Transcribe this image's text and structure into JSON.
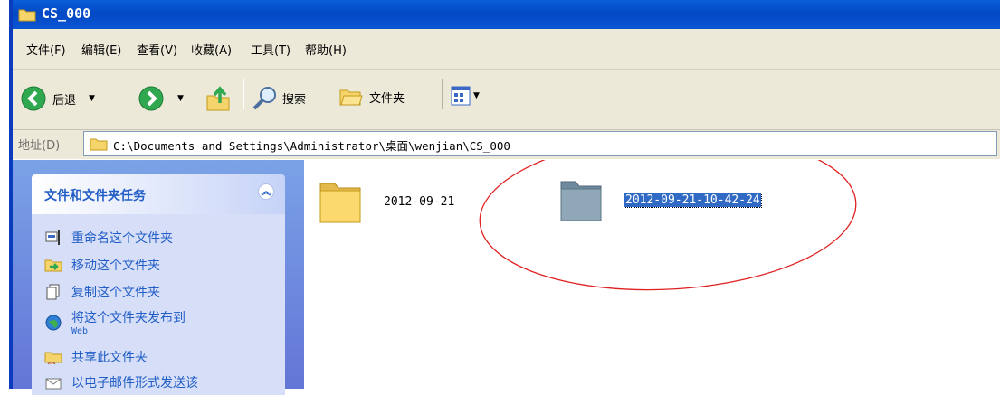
{
  "window": {
    "title": "CS_000"
  },
  "menu": [
    "文件(F)",
    "编辑(E)",
    "查看(V)",
    "收藏(A)",
    "工具(T)",
    "帮助(H)"
  ],
  "toolbar": {
    "back": "后退",
    "search": "搜索",
    "folders": "文件夹"
  },
  "address": {
    "label": "地址(D)",
    "path": "C:\\Documents and Settings\\Administrator\\桌面\\wenjian\\CS_000"
  },
  "tasks_panel": {
    "title": "文件和文件夹任务",
    "items": [
      {
        "label": "重命名这个文件夹",
        "icon": "rename-icon"
      },
      {
        "label": "移动这个文件夹",
        "icon": "move-icon"
      },
      {
        "label": "复制这个文件夹",
        "icon": "copy-icon"
      },
      {
        "label": "将这个文件夹发布到",
        "sub": "Web",
        "icon": "publish-web-icon"
      },
      {
        "label": "共享此文件夹",
        "icon": "share-icon"
      },
      {
        "label": "以电子邮件形式发送该",
        "icon": "email-icon"
      }
    ]
  },
  "files": [
    {
      "name": "2012-09-21",
      "selected": false
    },
    {
      "name": "2012-09-21-10-42-24",
      "selected": true
    }
  ],
  "colors": {
    "titlebar": "#0a5fd8",
    "link": "#215dc6",
    "selection": "#316ac5",
    "annotation": "#e02020"
  }
}
